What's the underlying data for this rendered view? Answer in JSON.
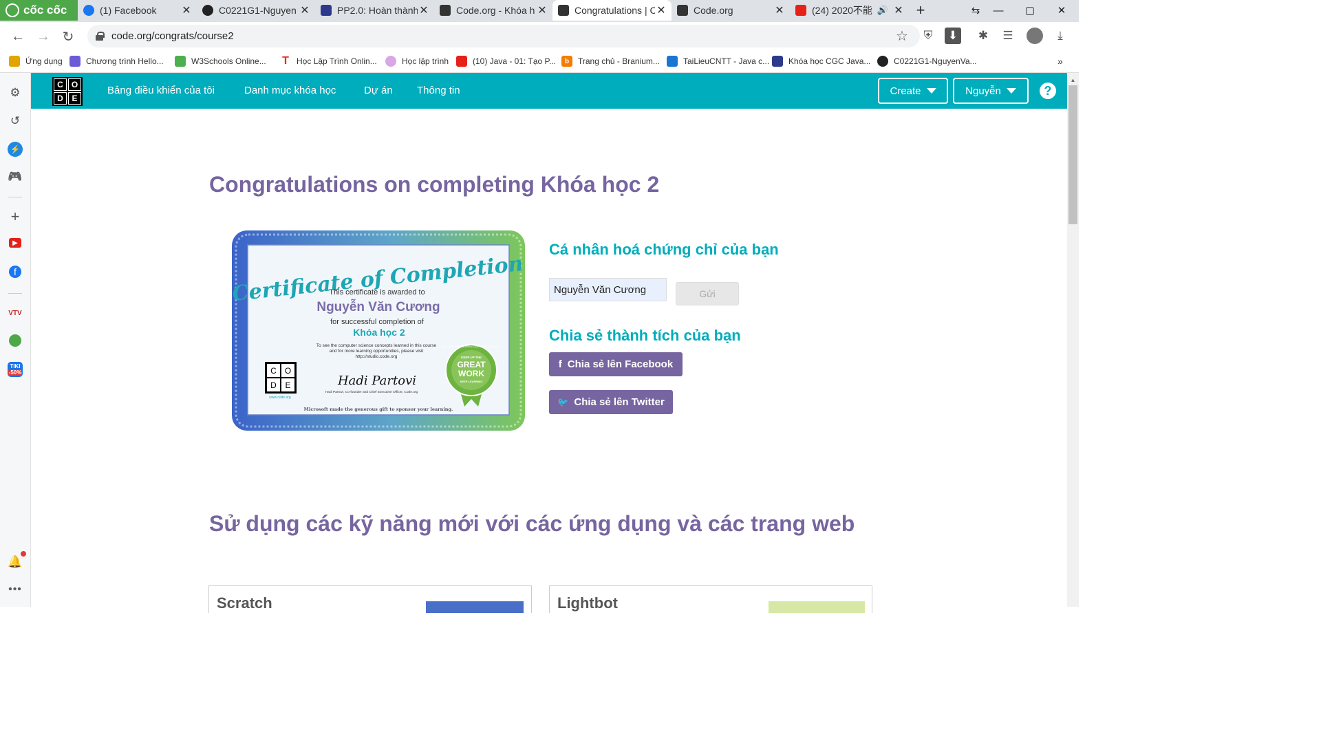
{
  "browser": {
    "brand": "cốc cốc",
    "tabs": [
      {
        "title": "(1) Facebook",
        "color": "#1877f2"
      },
      {
        "title": "C0221G1-Nguyen",
        "color": "#222222"
      },
      {
        "title": "PP2.0: Hoàn thành",
        "color": "#2d3a8c"
      },
      {
        "title": "Code.org - Khóa h",
        "color": "#333333"
      },
      {
        "title": "Congratulations | C",
        "color": "#333333",
        "active": true
      },
      {
        "title": "Code.org",
        "color": "#333333"
      },
      {
        "title": "(24) 2020不能",
        "color": "#e62117"
      }
    ],
    "url": "code.org/congrats/course2",
    "bookmarks": [
      {
        "label": "Ứng dụng",
        "color": "#e2a400"
      },
      {
        "label": "Chương trình Hello...",
        "color": "#6b5bd6"
      },
      {
        "label": "W3Schools Online...",
        "color": "#4caf50"
      },
      {
        "label": "Học Lập Trình Onlin...",
        "color": "#e62b1e"
      },
      {
        "label": "Học lập trình",
        "color": "#d9a6e6"
      },
      {
        "label": "(10) Java - 01: Tạo P...",
        "color": "#e62117"
      },
      {
        "label": "Trang chủ - Branium...",
        "color": "#f57c00"
      },
      {
        "label": "TaiLieuCNTT - Java c...",
        "color": "#1976d2"
      },
      {
        "label": "Khóa học CGC Java...",
        "color": "#2d3a8c"
      },
      {
        "label": "C0221G1-NguyenVa...",
        "color": "#222222"
      }
    ]
  },
  "sidebar": {
    "items": [
      "settings-icon",
      "history-icon",
      "messenger-icon",
      "game-icon",
      "plus-icon",
      "youtube-icon",
      "facebook-icon",
      "vtv-icon",
      "coccoc-map-icon",
      "tiki-icon"
    ],
    "tiki_label": "TIKI",
    "tiki_badge": "-50%",
    "vtv_label": "VTV"
  },
  "header": {
    "logo_letters": [
      "C",
      "O",
      "D",
      "E"
    ],
    "nav": [
      "Bảng điều khiển của tôi",
      "Danh mục khóa học",
      "Dự án",
      "Thông tin"
    ],
    "create_label": "Create",
    "user_label": "Nguyễn",
    "help_label": "?"
  },
  "main": {
    "title": "Congratulations on completing Khóa học 2",
    "certificate": {
      "heading": "Certificate of Completion",
      "awarded": "This certificate is awarded to",
      "name": "Nguyễn Văn Cương",
      "for_text": "for successful completion of",
      "course": "Khóa học 2",
      "fine_print_1": "To see the computer science concepts learned in this course",
      "fine_print_2": "and for more learning opportunities, please visit",
      "fine_print_3": "http://studio.code.org",
      "signature": "Hadi Partovi",
      "signer": "Hadi Partovi, Co-founder and Chief Executive Officer, Code.org",
      "sponsor": "Microsoft made the generous gift to sponsor your learning.",
      "logo_url": "www.code.org",
      "seal_top": "KEEP UP THE",
      "seal_main_1": "GREAT",
      "seal_main_2": "WORK",
      "seal_bottom": "KEEP LEARNING",
      "seal_ring": "ANYONE CAN LEARN COMPUTER SCIENCE"
    },
    "personalize_heading": "Cá nhân hoá chứng chỉ của bạn",
    "name_value": "Nguyễn Văn Cương",
    "send_label": "Gửi",
    "share_heading": "Chia sẻ thành tích của bạn",
    "share_facebook": "Chia sẻ lên Facebook",
    "share_twitter": "Chia sẻ lên Twitter",
    "apps_heading": "Sử dụng các kỹ năng mới với các ứng dụng và các trang web",
    "cards": [
      "Scratch",
      "Lightbot"
    ]
  },
  "colors": {
    "teal": "#00adbc",
    "purple": "#7665a0",
    "coccoc_green": "#4ea84a"
  }
}
